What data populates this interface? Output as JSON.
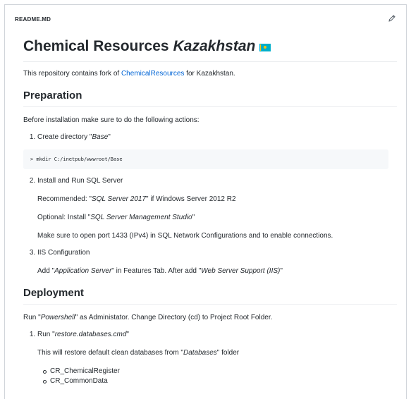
{
  "header": {
    "title": "README.MD"
  },
  "readme": {
    "h1_text": "Chemical Resources",
    "h1_em": "Kazakhstan",
    "intro_prefix": "This repository contains fork of ",
    "intro_link": "ChemicalResources",
    "intro_suffix": " for Kazakhstan.",
    "preparation": {
      "heading": "Preparation",
      "text": "Before installation make sure to do the following actions:",
      "step1": {
        "prefix": "Create directory \"",
        "em": "Base",
        "suffix": "\""
      },
      "code": "> mkdir C:/inetpub/wwwroot/Base",
      "step2": {
        "text": "Install and Run SQL Server"
      },
      "recommended": {
        "prefix": "Recommended: \"",
        "em": "SQL Server 2017",
        "suffix": "\" if Windows Server 2012 R2"
      },
      "optional": {
        "prefix": "Optional: Install \"",
        "em": "SQL Server Management Studio",
        "suffix": "\""
      },
      "port": "Make sure to open port 1433 (IPv4) in SQL Network Configurations and to enable connections.",
      "step3": {
        "text": "IIS Configuration"
      },
      "iis": {
        "prefix": "Add \"",
        "em1": "Application Server",
        "mid": "\" in Features Tab. After add \"",
        "em2": "Web Server Support (IIS)",
        "suffix": "\""
      }
    },
    "deployment": {
      "heading": "Deployment",
      "text": {
        "prefix": "Run \"",
        "em": "Powershell",
        "suffix": "\" as Administator. Change Directory (cd) to Project Root Folder."
      },
      "step1": {
        "prefix": "Run \"",
        "em": "restore.databases.cmd",
        "suffix": "\""
      },
      "restore": {
        "prefix": "This will restore default clean databases from \"",
        "em": "Databases",
        "suffix": "\" folder"
      },
      "databases": [
        "CR_ChemicalRegister",
        "CR_CommonData"
      ]
    }
  },
  "colors": {
    "link": "#0366d6",
    "flag": "#00afca"
  },
  "icons": {
    "edit": "pencil-icon",
    "flag": "kazakhstan-flag-icon"
  }
}
